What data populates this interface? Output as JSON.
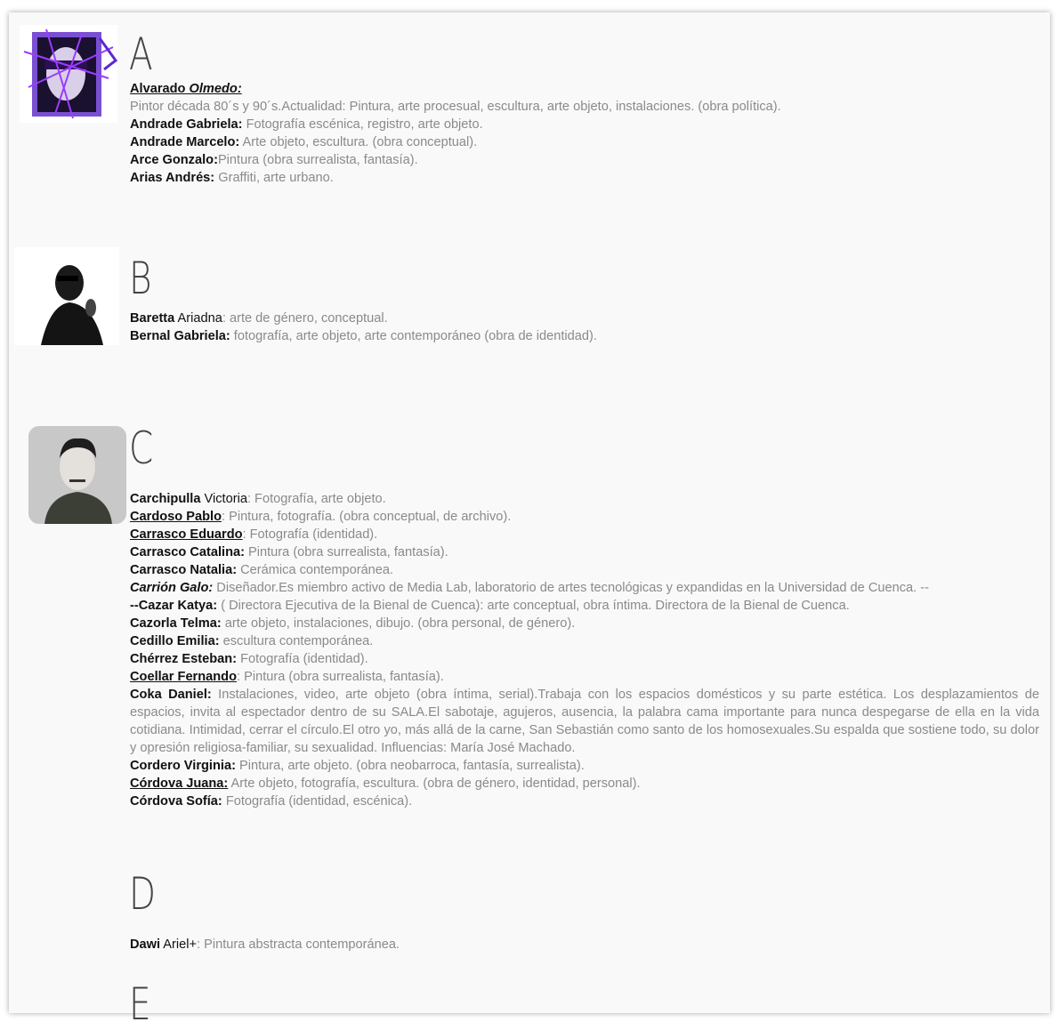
{
  "sections": {
    "a": {
      "letter": "A",
      "entries": [
        {
          "name_a": "Alvarado",
          "name_b": "Olmedo:",
          "text": "Pintor década 80´s y 90´s.Actualidad: Pintura, arte procesual, escultura, arte objeto, instalaciones. (obra política)."
        },
        {
          "name": "Andrade Gabriela:",
          "text": " Fotografía escénica, registro, arte objeto."
        },
        {
          "name": "Andrade Marcelo:",
          "text": " Arte objeto, escultura. (obra conceptual)."
        },
        {
          "name": "Arce Gonzalo:",
          "text": "Pintura (obra surrealista, fantasía)."
        },
        {
          "name": "Arias Andrés:",
          "text": " Graffiti, arte urbano."
        }
      ]
    },
    "b": {
      "letter": "B",
      "entries": [
        {
          "name": "Baretta",
          "first": " Ariadna",
          "text": ": arte de género, conceptual."
        },
        {
          "name": "Bernal Gabriela:",
          "text": " fotografía, arte objeto, arte contemporáneo (obra de identidad)."
        }
      ]
    },
    "c": {
      "letter": "C",
      "entries": [
        {
          "name": "Carchipulla",
          "first": " Victoria",
          "text": ": Fotografía, arte objeto."
        },
        {
          "name": "Cardoso Pablo",
          "text": ": Pintura, fotografía. (obra conceptual, de archivo)."
        },
        {
          "name": "Carrasco Eduardo",
          "text": ": Fotografía (identidad)."
        },
        {
          "name": "Carrasco Catalina:",
          "text": " Pintura (obra surrealista, fantasía)."
        },
        {
          "name": "Carrasco Natalia:",
          "text": " Cerámica contemporánea."
        },
        {
          "name": "Carrión Galo:",
          "text": " Diseñador.Es miembro activo de Media Lab, laboratorio de artes tecnológicas y expandidas en la Universidad de Cuenca. --"
        },
        {
          "name": "--Cazar Katya:",
          "text": " ( Directora Ejecutiva de la Bienal de Cuenca): arte conceptual, obra íntima. Directora de la Bienal de Cuenca."
        },
        {
          "name": "Cazorla Telma:",
          "text": " arte objeto, instalaciones, dibujo. (obra personal, de género)."
        },
        {
          "name": "Cedillo Emilia:",
          "text": " escultura contemporánea."
        },
        {
          "name": "Chérrez Esteban:",
          "text": " Fotografía (identidad)."
        },
        {
          "name": "Coellar Fernando",
          "text": ": Pintura (obra surrealista, fantasía)."
        },
        {
          "name": "Coka Daniel:",
          "text": " Instalaciones, video, arte objeto (obra íntima, serial).Trabaja con los espacios domésticos y su parte estética. Los desplazamientos de espacios, invita al espectador dentro de su SALA.El sabotaje, agujeros, ausencia, la palabra cama importante para nunca despegarse de ella en la vida cotidiana. Intimidad, cerrar el círculo.El otro yo, más allá de la carne, San Sebastián como santo de los homosexuales.Su espalda que sostiene todo, su dolor y opresión religiosa-familiar, su sexualidad. Influencias: María José Machado."
        },
        {
          "name": "Cordero Virginia:",
          "text": " Pintura, arte objeto. (obra neobarroca, fantasía, surrealista)."
        },
        {
          "name": "Córdova Juana:",
          "text": " Arte objeto, fotografía, escultura. (obra de género, identidad, personal)."
        },
        {
          "name": "Córdova Sofía:",
          "text": " Fotografía (identidad, escénica)."
        }
      ]
    },
    "d": {
      "letter": "D",
      "entries": [
        {
          "name": "Dawi",
          "first": " Ariel+",
          "text": ": Pintura abstracta contemporánea."
        }
      ]
    },
    "e": {
      "letter": "E"
    }
  }
}
